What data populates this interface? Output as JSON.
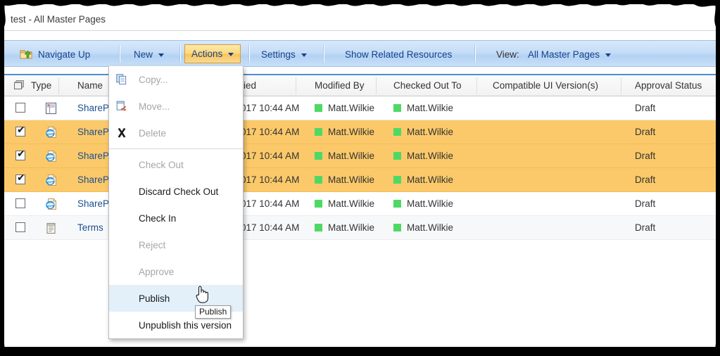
{
  "breadcrumb": {
    "text": "test - All Master Pages"
  },
  "toolbar": {
    "navigate_up": "Navigate Up",
    "navigate_up_icon": "folder-up-icon",
    "new": "New",
    "actions": "Actions",
    "settings": "Settings",
    "show_related": "Show Related Resources",
    "view_label": "View:",
    "view_value": "All Master Pages",
    "actions_accent": "#f8c45a",
    "ribbon_accent": "#c5ddf7"
  },
  "menu": {
    "items": [
      {
        "label": "Copy...",
        "icon": "copy-icon",
        "state": "disabled",
        "sep_after": false
      },
      {
        "label": "Move...",
        "icon": "move-icon",
        "state": "disabled",
        "sep_after": false
      },
      {
        "label": "Delete",
        "icon": "delete-icon",
        "state": "disabled",
        "sep_after": true
      },
      {
        "label": "Check Out",
        "icon": "",
        "state": "disabled",
        "sep_after": false
      },
      {
        "label": "Discard Check Out",
        "icon": "",
        "state": "enabled",
        "sep_after": false
      },
      {
        "label": "Check In",
        "icon": "",
        "state": "enabled",
        "sep_after": false
      },
      {
        "label": "Reject",
        "icon": "",
        "state": "disabled",
        "sep_after": false
      },
      {
        "label": "Approve",
        "icon": "",
        "state": "disabled",
        "sep_after": false
      },
      {
        "label": "Publish",
        "icon": "",
        "state": "hover",
        "sep_after": false
      },
      {
        "label": "Unpublish this version",
        "icon": "",
        "state": "enabled",
        "sep_after": false
      }
    ],
    "tooltip": "Publish"
  },
  "table": {
    "columns": [
      {
        "label": "Type"
      },
      {
        "label": "Name"
      },
      {
        "label": "ied"
      },
      {
        "label": "Modified By"
      },
      {
        "label": "Checked Out To"
      },
      {
        "label": "Compatible UI Version(s)"
      },
      {
        "label": "Approval Status"
      }
    ],
    "rows": [
      {
        "checked": false,
        "icon": "master-page-icon",
        "name": "ShareP",
        "modified": "017 10:44 AM",
        "modified_by": "Matt.Wilkie",
        "checked_out_to": "Matt.Wilkie",
        "ui_version": "",
        "approval": "Draft",
        "style": "plain"
      },
      {
        "checked": true,
        "icon": "html-page-icon",
        "name": "ShareP",
        "modified": "017 10:44 AM",
        "modified_by": "Matt.Wilkie",
        "checked_out_to": "Matt.Wilkie",
        "ui_version": "",
        "approval": "Draft",
        "style": "sel"
      },
      {
        "checked": true,
        "icon": "html-page-icon",
        "name": "ShareP",
        "modified": "017 10:44 AM",
        "modified_by": "Matt.Wilkie",
        "checked_out_to": "Matt.Wilkie",
        "ui_version": "",
        "approval": "Draft",
        "style": "sel"
      },
      {
        "checked": true,
        "icon": "html-page-icon",
        "name": "ShareP",
        "modified": "017 10:44 AM",
        "modified_by": "Matt.Wilkie",
        "checked_out_to": "Matt.Wilkie",
        "ui_version": "",
        "approval": "Draft",
        "style": "sel"
      },
      {
        "checked": false,
        "icon": "html-page-icon",
        "name": "ShareP",
        "modified": "017 10:44 AM",
        "modified_by": "Matt.Wilkie",
        "checked_out_to": "Matt.Wilkie",
        "ui_version": "",
        "approval": "Draft",
        "style": "plain"
      },
      {
        "checked": false,
        "icon": "terms-doc-icon",
        "name": "Terms",
        "modified": "017 10:44 AM",
        "modified_by": "Matt.Wilkie",
        "checked_out_to": "Matt.Wilkie",
        "ui_version": "",
        "approval": "Draft",
        "style": "alt"
      }
    ]
  }
}
